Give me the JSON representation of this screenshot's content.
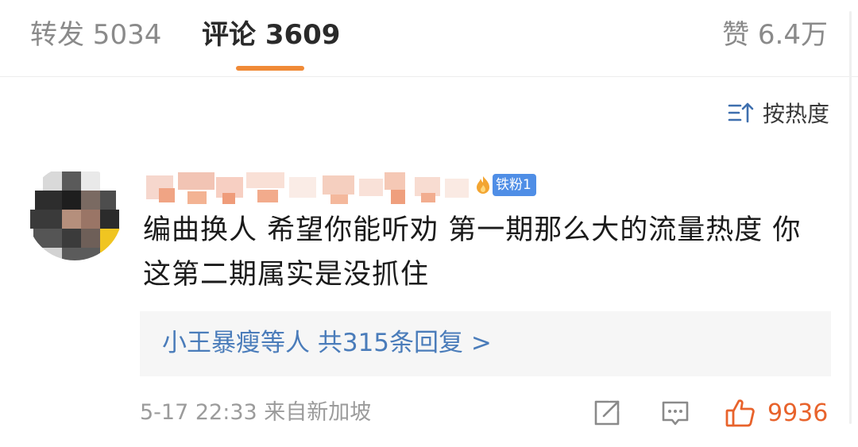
{
  "tabs": {
    "repost": "转发 5034",
    "comments": "评论 3609",
    "likes": "赞 6.4万"
  },
  "sort": {
    "label": "按热度",
    "icon": "sort-icon"
  },
  "comment": {
    "badge": "铁粉1",
    "text": "编曲换人 希望你能听劝 第一期那么大的流量热度 你这第二期属实是没抓住",
    "replies": "小王暴瘦等人 共315条回复 >",
    "timestamp": "5-17 22:33 来自新加坡",
    "like_count": "9936"
  },
  "colors": {
    "accent": "#f08a37",
    "link": "#4a7cba",
    "like": "#e8632c",
    "badge": "#4f8ee6"
  }
}
